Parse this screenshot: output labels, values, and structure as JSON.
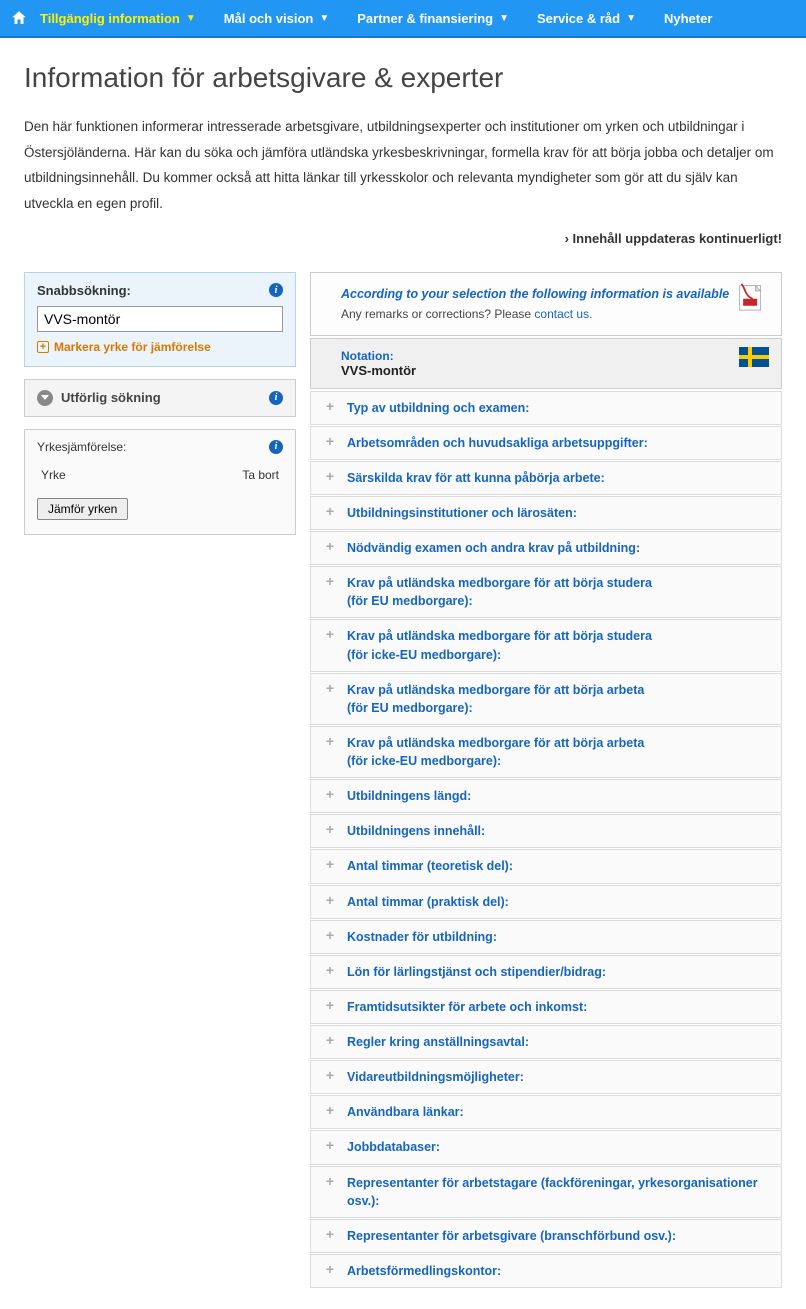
{
  "nav": {
    "items": [
      {
        "label": "Tillgänglig information",
        "active": true,
        "dropdown": true
      },
      {
        "label": "Mål och vision",
        "active": false,
        "dropdown": true
      },
      {
        "label": "Partner & finansiering",
        "active": false,
        "dropdown": true
      },
      {
        "label": "Service & råd",
        "active": false,
        "dropdown": true
      },
      {
        "label": "Nyheter",
        "active": false,
        "dropdown": false
      }
    ]
  },
  "page": {
    "title": "Information för arbetsgivare & experter",
    "intro": "Den här funktionen informerar intresserade arbetsgivare, utbildningsexperter och institutioner om yrken och utbildningar i Östersjöländerna. Här kan du söka och jämföra utländska yrkesbeskrivningar, formella krav för att börja jobba och detaljer om utbildningsinnehåll. Du kommer också att hitta länkar till yrkesskolor och relevanta myndigheter som gör att du själv kan utveckla en egen profil.",
    "continuous": "› Innehåll uppdateras kontinuerligt!"
  },
  "quicksearch": {
    "title": "Snabbsökning:",
    "value": "VVS-montör",
    "mark_label": "Markera yrke för jämförelse"
  },
  "detailed": {
    "label": "Utförlig sökning"
  },
  "compare": {
    "title": "Yrkesjämförelse:",
    "col1": "Yrke",
    "col2": "Ta bort",
    "button": "Jämför yrken"
  },
  "selection": {
    "text": "According to your selection the following information is available",
    "remark_prefix": "Any remarks or corrections? Please ",
    "remark_link": "contact us."
  },
  "notation": {
    "label": "Notation:",
    "value": "VVS-montör"
  },
  "accordion": [
    "Typ av utbildning och examen:",
    "Arbetsområden och huvudsakliga arbetsuppgifter:",
    "Särskilda krav för att kunna påbörja arbete:",
    "Utbildningsinstitutioner och lärosäten:",
    "Nödvändig examen och andra krav på utbildning:",
    "Krav på utländska medborgare för att börja studera\n(för EU medborgare):",
    "Krav på utländska medborgare för att börja studera\n(för icke-EU medborgare):",
    "Krav på utländska medborgare för att börja arbeta\n(för EU medborgare):",
    "Krav på utländska medborgare för att börja arbeta\n(för icke-EU medborgare):",
    "Utbildningens längd:",
    "Utbildningens innehåll:",
    "Antal timmar (teoretisk del):",
    "Antal timmar (praktisk del):",
    "Kostnader för utbildning:",
    "Lön för lärlingstjänst och stipendier/bidrag:",
    "Framtidsutsikter för arbete och inkomst:",
    "Regler kring anställningsavtal:",
    "Vidareutbildningsmöjligheter:",
    "Användbara länkar:",
    "Jobbdatabaser:",
    "Representanter för arbetstagare (fackföreningar, yrkesorganisationer osv.):",
    "Representanter för arbetsgivare (branschförbund osv.):",
    "Arbetsförmedlingskontor:"
  ]
}
